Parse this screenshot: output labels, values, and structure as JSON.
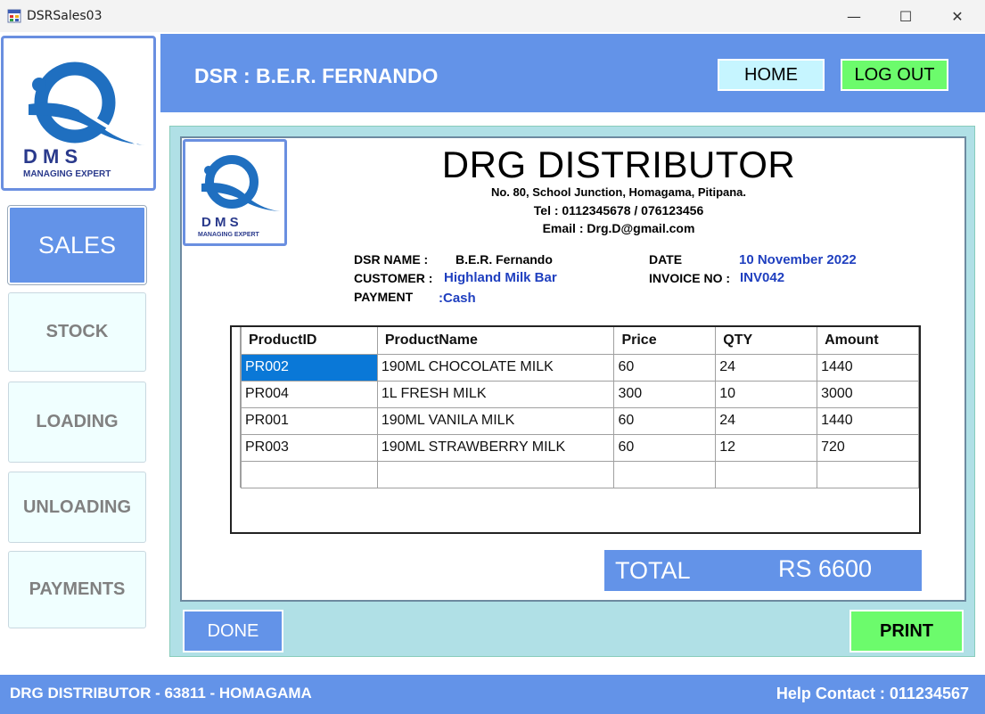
{
  "window": {
    "title": "DSRSales03",
    "controls": {
      "minimize": "—",
      "maximize": "☐",
      "close": "✕"
    }
  },
  "header": {
    "dsr_title": "DSR : B.E.R. FERNANDO",
    "home_label": "HOME",
    "logout_label": "LOG OUT"
  },
  "logo": {
    "letters": "D M S",
    "tagline": "MANAGING EXPERT"
  },
  "sidebar": {
    "items": [
      {
        "label": "SALES",
        "active": true
      },
      {
        "label": "STOCK"
      },
      {
        "label": "LOADING"
      },
      {
        "label": "UNLOADING"
      },
      {
        "label": "PAYMENTS"
      }
    ]
  },
  "invoice": {
    "company": "DRG DISTRIBUTOR",
    "address_line": "No. 80, School Junction, Homagama, Pitipana.",
    "tel_line": "Tel : 0112345678 / 076123456",
    "email_line": "Email : Drg.D@gmail.com",
    "dsr_name_label": "DSR NAME :",
    "dsr_name_value": "B.E.R. Fernando",
    "customer_label": "CUSTOMER :",
    "customer_value": "Highland Milk Bar",
    "payment_label": "PAYMENT",
    "payment_value": ":Cash",
    "date_label": "DATE",
    "date_value": "10 November 2022",
    "invoice_no_label": "INVOICE NO :",
    "invoice_no_value": "INV042",
    "columns": [
      "ProductID",
      "ProductName",
      "Price",
      "QTY",
      "Amount"
    ],
    "rows": [
      [
        "PR002",
        "190ML CHOCOLATE MILK",
        "60",
        "24",
        "1440"
      ],
      [
        "PR004",
        "1L FRESH MILK",
        "300",
        "10",
        "3000"
      ],
      [
        "PR001",
        "190ML VANILA MILK",
        "60",
        "24",
        "1440"
      ],
      [
        "PR003",
        "190ML STRAWBERRY MILK",
        "60",
        "12",
        "720"
      ]
    ],
    "total_label": "TOTAL",
    "total_value": "RS 6600"
  },
  "actions": {
    "done_label": "DONE",
    "print_label": "PRINT"
  },
  "footer": {
    "left": "DRG DISTRIBUTOR - 63811 - HOMAGAMA",
    "right": "Help  Contact : 011234567"
  },
  "colors": {
    "accent_blue": "#6393e8",
    "panel_teal": "#b0e0e6",
    "go_green": "#6cfb6c",
    "home_cyan": "#c6f5ff",
    "selection": "#0a78d7",
    "value_blue": "#1f3fbf"
  }
}
